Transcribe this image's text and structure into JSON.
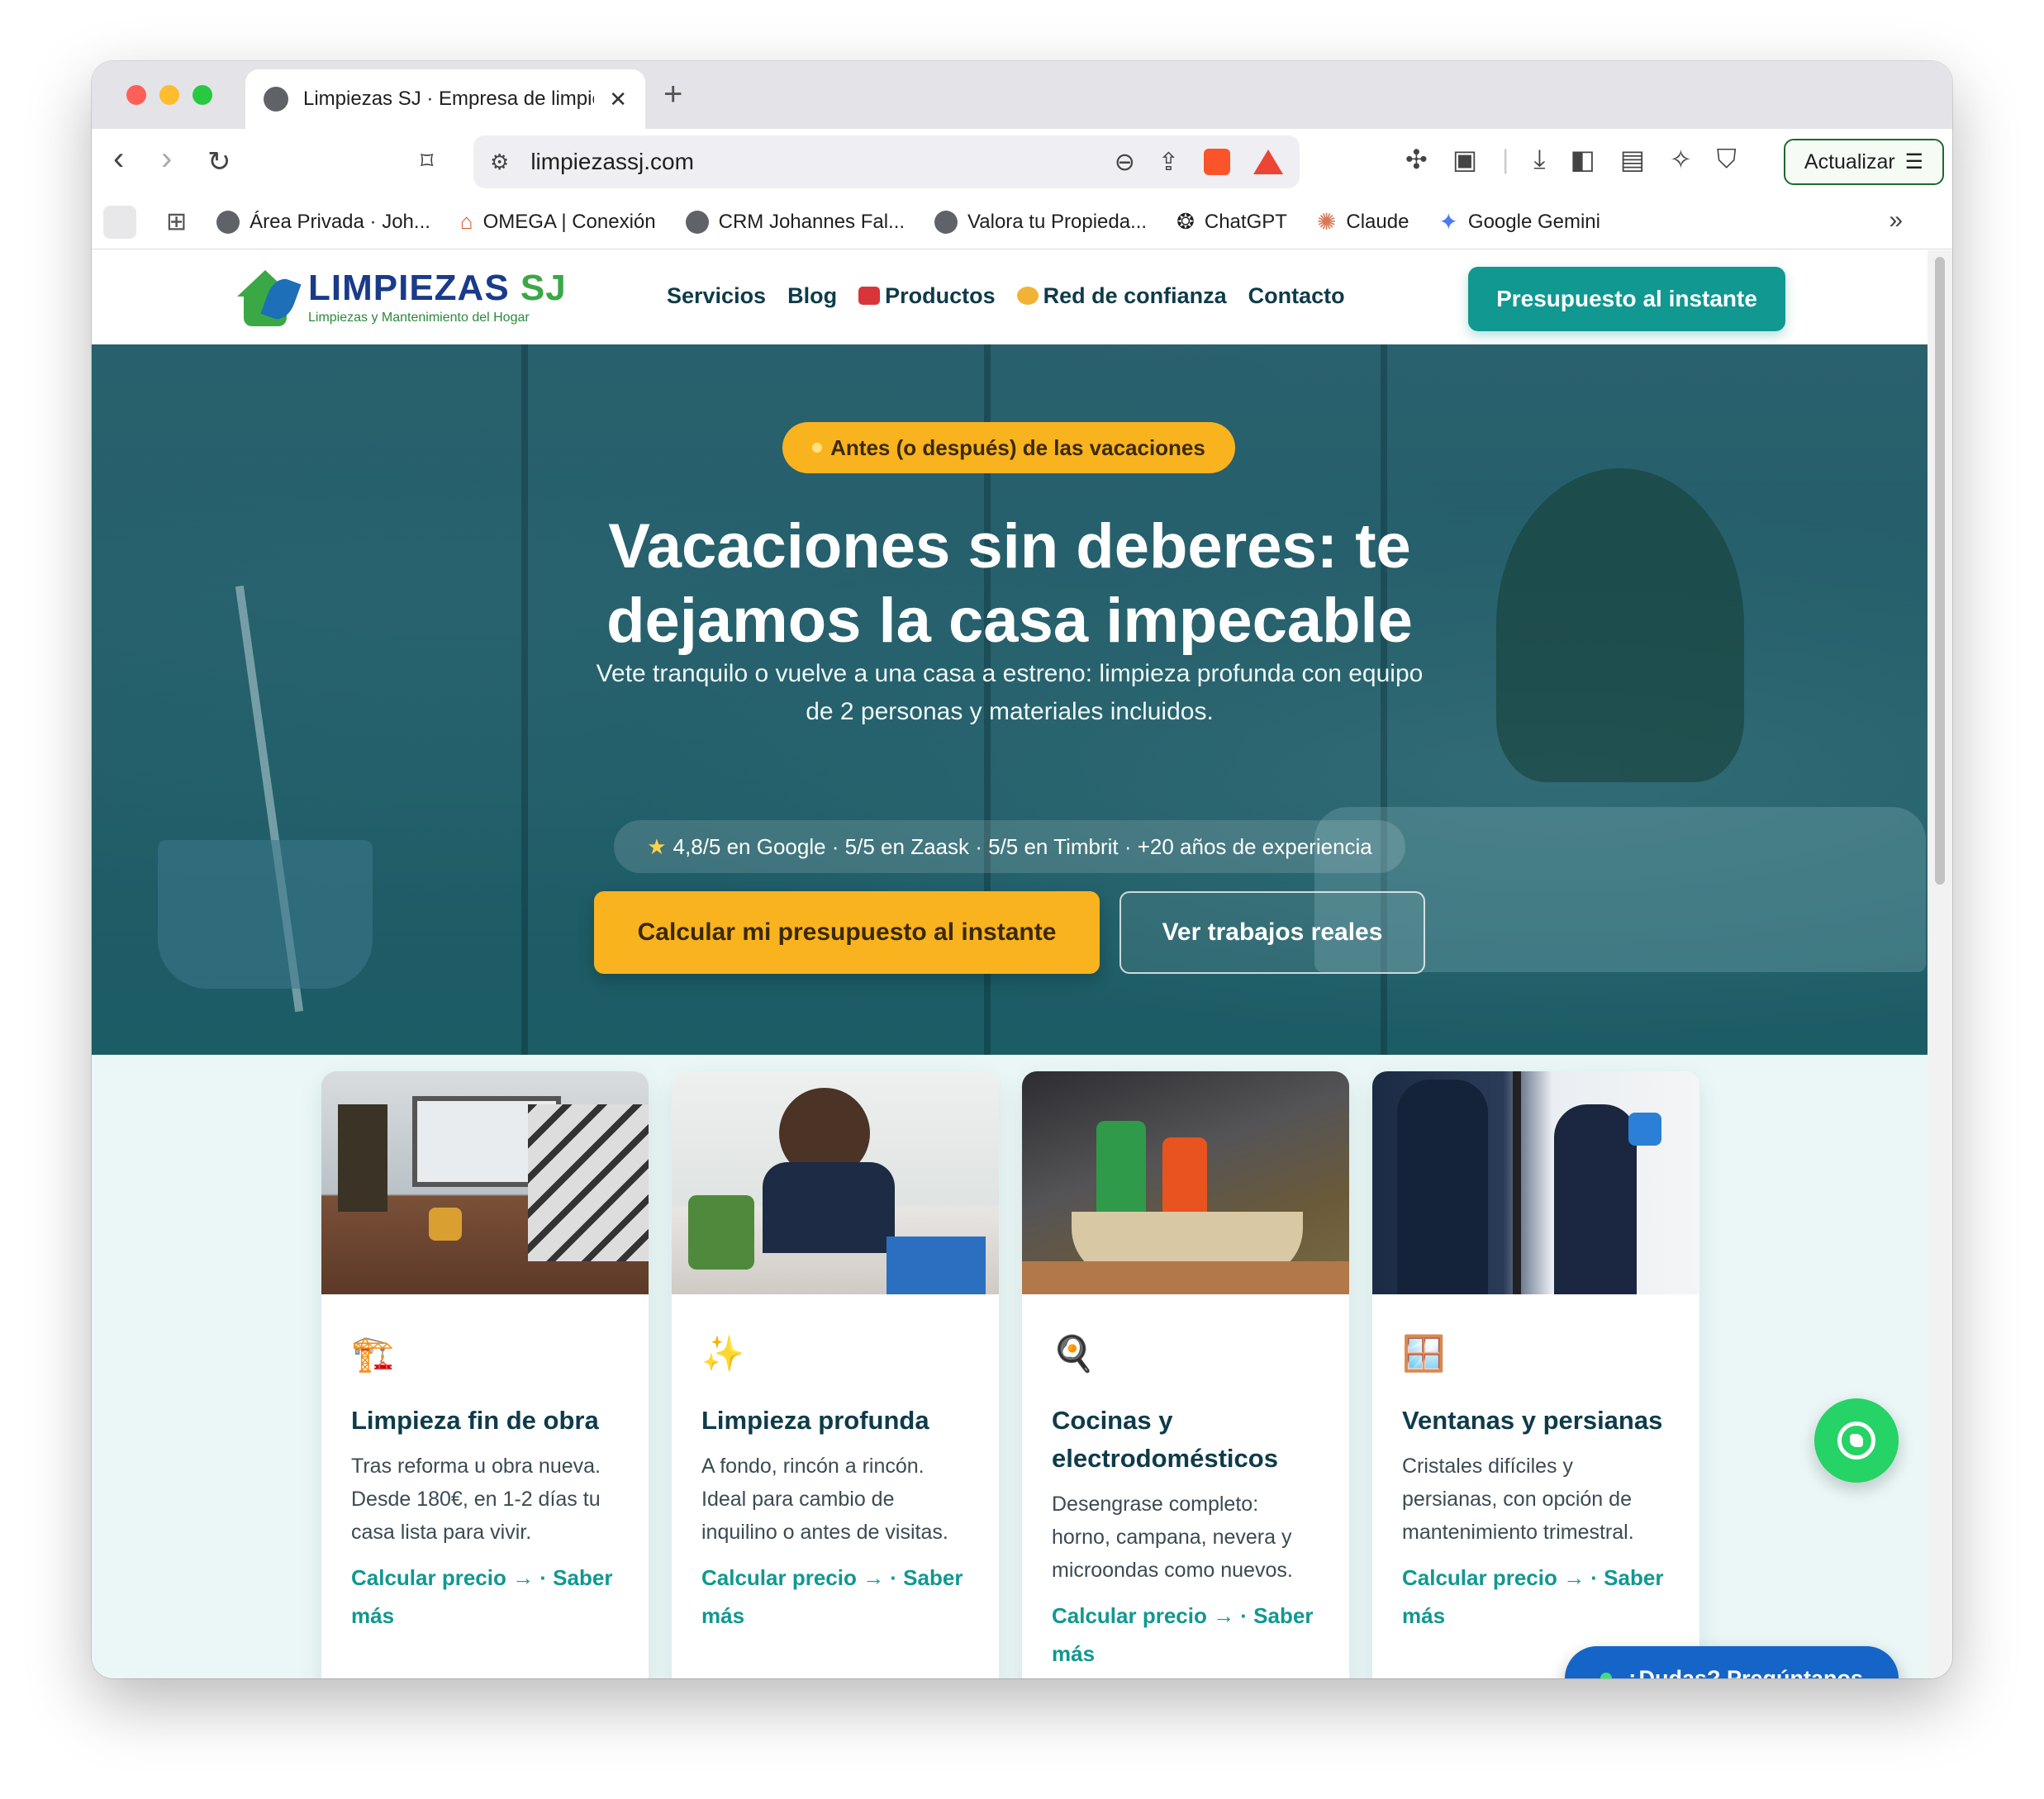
{
  "browser": {
    "tab_title": "Limpiezas SJ · Empresa de limpieza",
    "url": "limpiezassj.com",
    "update_label": "Actualizar",
    "bookmarks": [
      "Área Privada · Joh...",
      "OMEGA | Conexión",
      "CRM Johannes Fal...",
      "Valora tu Propieda...",
      "ChatGPT",
      "Claude",
      "Google Gemini"
    ]
  },
  "site": {
    "brand": "LIMPIEZAS",
    "brand_accent": "SJ",
    "tagline": "Limpiezas y Mantenimiento del Hogar",
    "nav": [
      "Servicios",
      "Blog",
      "Productos",
      "Red de confianza",
      "Contacto"
    ],
    "header_cta": "Presupuesto al instante"
  },
  "hero": {
    "pill": "Antes (o después) de las vacaciones",
    "title_line1": "Vacaciones sin deberes: te",
    "title_line2": "dejamos la casa impecable",
    "subtitle": "Vete tranquilo o vuelve a una casa a estreno: limpieza profunda con equipo de 2 personas y materiales incluidos.",
    "trust": "4,8/5 en Google · 5/5 en Zaask · 5/5 en Timbrit · +20 años de experiencia",
    "primary_cta": "Calcular mi presupuesto al instante",
    "secondary_cta": "Ver trabajos reales"
  },
  "cards": [
    {
      "icon": "🏗️",
      "title": "Limpieza fin de obra",
      "text": "Tras reforma u obra nueva. Desde 180€, en 1-2 días tu casa lista para vivir.",
      "links": "Calcular precio → · Saber más"
    },
    {
      "icon": "✨",
      "title": "Limpieza profunda",
      "text": "A fondo, rincón a rincón. Ideal para cambio de inquilino o antes de visitas.",
      "links": "Calcular precio → · Saber más"
    },
    {
      "icon": "🍳",
      "title": "Cocinas y electrodomésticos",
      "text": "Desengrase completo: horno, campana, nevera y microondas como nuevos.",
      "links": "Calcular precio → · Saber más"
    },
    {
      "icon": "🪟",
      "title": "Ventanas y persianas",
      "text": "Cristales difíciles y persianas, con opción de mantenimiento trimestral.",
      "links": "Calcular precio → · Saber más"
    }
  ],
  "chat": {
    "ask_label": "¿Dudas? Pregúntanos"
  },
  "colors": {
    "teal": "#109891",
    "amber": "#f9b31f",
    "navy": "#0e3b4a",
    "whatsapp": "#25d366",
    "chat_blue": "#1565c8"
  }
}
